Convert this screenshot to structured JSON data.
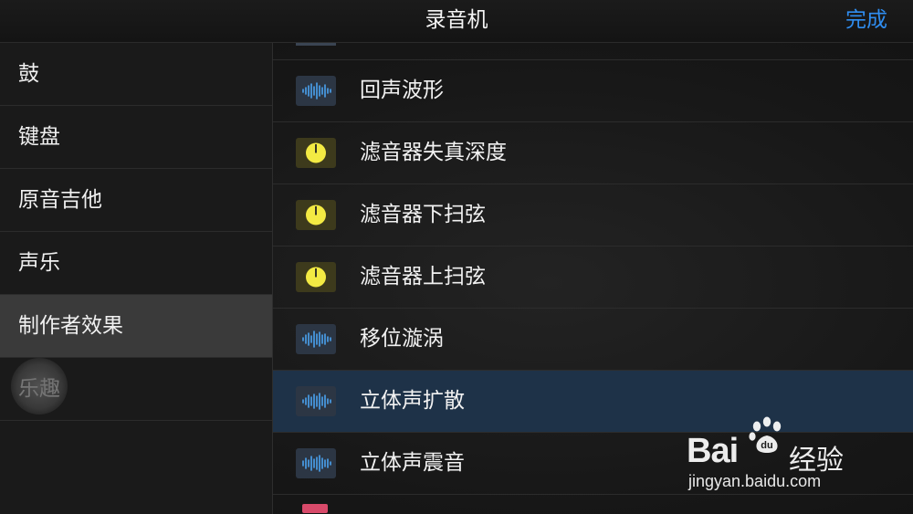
{
  "header": {
    "title": "录音机",
    "done_label": "完成"
  },
  "sidebar": {
    "items": [
      {
        "label": "鼓",
        "selected": false
      },
      {
        "label": "键盘",
        "selected": false
      },
      {
        "label": "原音吉他",
        "selected": false
      },
      {
        "label": "声乐",
        "selected": false
      },
      {
        "label": "制作者效果",
        "selected": true
      },
      {
        "label": "乐趣",
        "selected": false
      }
    ]
  },
  "effects": {
    "items": [
      {
        "label": "回声波形",
        "icon": "waveform-icon",
        "selected": false
      },
      {
        "label": "滤音器失真深度",
        "icon": "knob-icon",
        "selected": false
      },
      {
        "label": "滤音器下扫弦",
        "icon": "knob-icon",
        "selected": false
      },
      {
        "label": "滤音器上扫弦",
        "icon": "knob-icon",
        "selected": false
      },
      {
        "label": "移位漩涡",
        "icon": "waveform-icon",
        "selected": false
      },
      {
        "label": "立体声扩散",
        "icon": "waveform-icon",
        "selected": true
      },
      {
        "label": "立体声震音",
        "icon": "waveform-icon",
        "selected": false
      }
    ]
  },
  "watermark": {
    "brand": "Bai",
    "brand_cn": "经验",
    "url": "jingyan.baidu.com"
  },
  "colors": {
    "accent": "#2f8df0",
    "selected_row": "#1e3248",
    "knob_yellow": "#f3ea43",
    "waveform_blue": "#4aa3f0"
  }
}
